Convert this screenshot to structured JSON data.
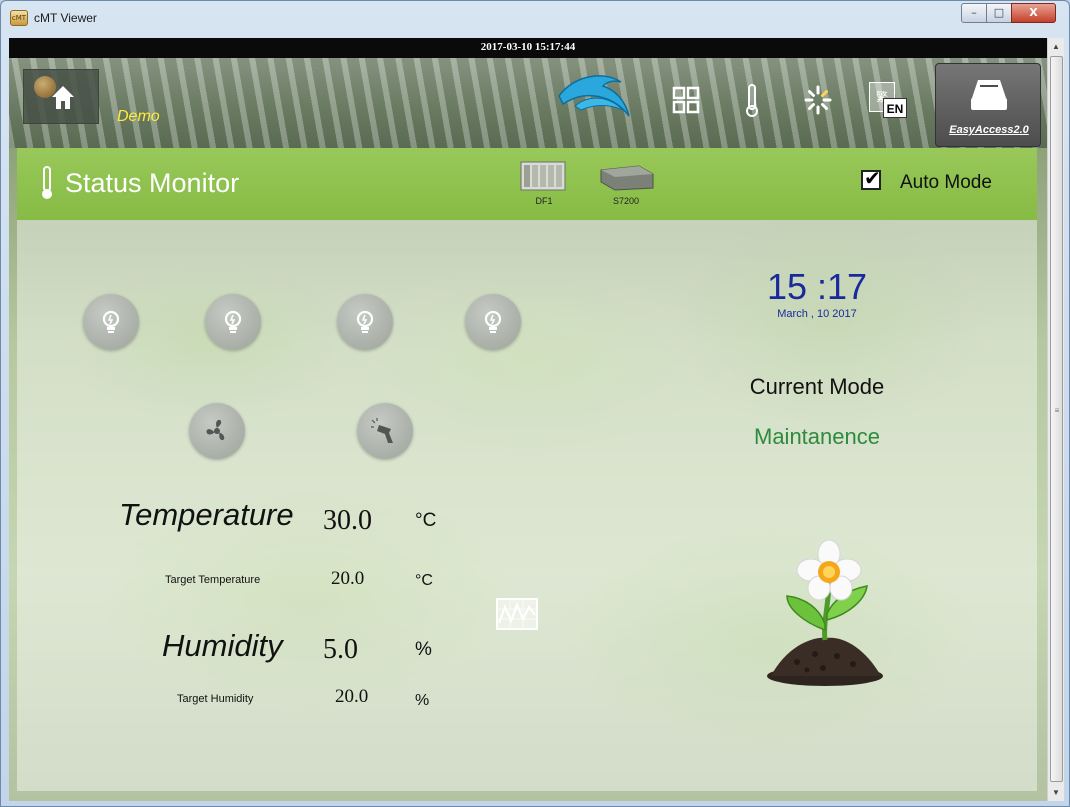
{
  "window": {
    "title": "cMT Viewer",
    "app_icon_text": "cMT",
    "minimize_symbol": "–",
    "maximize_symbol": "□",
    "close_symbol": "X"
  },
  "topbar": {
    "datetime": "2017-03-10 15:17:44"
  },
  "toolbar": {
    "project_label": "Demo",
    "icons": [
      "home-icon",
      "dolphin-logo-icon",
      "grid-menu-icon",
      "thermometer-icon",
      "loading-spinner-icon",
      "language-icon"
    ],
    "language_code": "EN",
    "language_char": "繁",
    "easyaccess_label": "EasyAccess2.0"
  },
  "header": {
    "title": "Status Monitor",
    "plcs": [
      "DF1",
      "S7200"
    ],
    "auto_mode_label": "Auto Mode",
    "auto_mode_checked": true,
    "checkmark": "✔"
  },
  "controls": {
    "lights": [
      "light-bulb-icon",
      "light-bulb-icon",
      "light-bulb-icon",
      "light-bulb-icon"
    ],
    "fan": "fan-icon",
    "sprayer": "sprayer-icon",
    "trend": "trend-chart-icon"
  },
  "readings": {
    "temperature_label": "Temperature",
    "temperature_value": "30.0",
    "temperature_unit": "°C",
    "target_temperature_label": "Target Temperature",
    "target_temperature_value": "20.0",
    "target_temperature_unit": "°C",
    "humidity_label": "Humidity",
    "humidity_value": "5.0",
    "humidity_unit": "%",
    "target_humidity_label": "Target Humidity",
    "target_humidity_value": "20.0",
    "target_humidity_unit": "%"
  },
  "clock": {
    "time": "15 :17",
    "date": "March , 10  2017"
  },
  "mode": {
    "label": "Current Mode",
    "value": "Maintanence"
  },
  "colors": {
    "header_green": "#8cc04a",
    "clock_blue": "#1a2a9c",
    "mode_green": "#2e8b3e",
    "demo_yellow": "#ffeb3b"
  }
}
